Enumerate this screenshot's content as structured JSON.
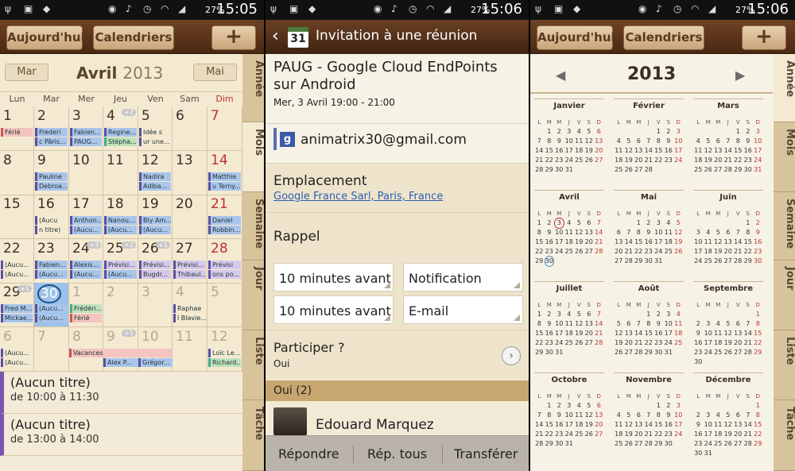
{
  "status_bar": {
    "time": "15:05",
    "battery": "27%",
    "time_p2": "15:06",
    "time_p3": "15:06"
  },
  "toolbar": {
    "today_label": "Aujourd'hui",
    "calendars_label": "Calendriers",
    "add_label": "+"
  },
  "colors": {
    "toolbar": "#5a3218",
    "sunday": "#c0322a",
    "selected": "#9cc2e8",
    "event_blue": "#a9c5ea",
    "event_red": "#f3c4c0",
    "event_green": "#bde1bc",
    "event_purple": "#d6c9ec"
  },
  "side_tabs": [
    "Année",
    "Mois",
    "Semaine",
    "Jour",
    "Liste",
    "Tâche"
  ],
  "month_view": {
    "prev": "Mar",
    "next": "Mai",
    "title": "Avril",
    "year": "2013",
    "weekdays": [
      "Lun",
      "Mar",
      "Mer",
      "Jeu",
      "Ven",
      "Sam",
      "Dim"
    ],
    "weeks": [
      [
        {
          "n": "1",
          "ev": [
            {
              "t": "Férié",
              "c": "r"
            }
          ]
        },
        {
          "n": "2",
          "ev": [
            {
              "t": "Frederi",
              "c": "b"
            },
            {
              "t": "c Pâris...",
              "c": "b"
            }
          ]
        },
        {
          "n": "3",
          "ev": [
            {
              "t": "Fabien...",
              "c": "b"
            },
            {
              "t": "PAUG...",
              "c": "b"
            }
          ]
        },
        {
          "n": "4",
          "more": "+2",
          "ev": [
            {
              "t": "Regine...",
              "c": "b"
            },
            {
              "t": "Stépha...",
              "c": "g"
            }
          ]
        },
        {
          "n": "5",
          "ev": [
            {
              "t": "Idée s",
              "c": "t"
            },
            {
              "t": "ur une...",
              "c": "t"
            }
          ]
        },
        {
          "n": "6",
          "ev": []
        },
        {
          "n": "7",
          "ev": []
        }
      ],
      [
        {
          "n": "8",
          "ev": []
        },
        {
          "n": "9",
          "ev": [
            {
              "t": "Pauline",
              "c": "b"
            },
            {
              "t": "Debroa...",
              "c": "b"
            }
          ]
        },
        {
          "n": "10",
          "ev": []
        },
        {
          "n": "11",
          "ev": []
        },
        {
          "n": "12",
          "ev": [
            {
              "t": "Nadira",
              "c": "b"
            },
            {
              "t": "Adiba...",
              "c": "b"
            }
          ]
        },
        {
          "n": "13",
          "ev": []
        },
        {
          "n": "14",
          "ev": [
            {
              "t": "Matthie",
              "c": "b"
            },
            {
              "t": "u Terny...",
              "c": "b"
            }
          ]
        }
      ],
      [
        {
          "n": "15",
          "ev": []
        },
        {
          "n": "16",
          "ev": [
            {
              "t": "(Aucu",
              "c": "t"
            },
            {
              "t": "n titre)",
              "c": "t"
            }
          ]
        },
        {
          "n": "17",
          "ev": [
            {
              "t": "Anthon...",
              "c": "b"
            },
            {
              "t": "(Aucu...",
              "c": "b"
            }
          ]
        },
        {
          "n": "18",
          "ev": [
            {
              "t": "Nanou...",
              "c": "b"
            },
            {
              "t": "(Aucu...",
              "c": "b"
            }
          ]
        },
        {
          "n": "19",
          "ev": [
            {
              "t": "Bly Am...",
              "c": "b"
            },
            {
              "t": "(Aucu...",
              "c": "b"
            }
          ]
        },
        {
          "n": "20",
          "ev": []
        },
        {
          "n": "21",
          "ev": [
            {
              "t": "Daniel",
              "c": "b"
            },
            {
              "t": "Robbin...",
              "c": "b"
            }
          ]
        }
      ],
      [
        {
          "n": "22",
          "ev": [
            {
              "t": "(Aucu...",
              "c": "t"
            },
            {
              "t": "(Aucu...",
              "c": "t"
            }
          ]
        },
        {
          "n": "23",
          "ev": [
            {
              "t": "Fabien...",
              "c": "b"
            },
            {
              "t": "(Aucu...",
              "c": "b"
            }
          ]
        },
        {
          "n": "24",
          "more": "+3",
          "ev": [
            {
              "t": "Alexis...",
              "c": "b"
            },
            {
              "t": "(Aucu...",
              "c": "b"
            }
          ]
        },
        {
          "n": "25",
          "more": "+2",
          "ev": [
            {
              "t": "Prévisi...",
              "c": "p"
            },
            {
              "t": "(Aucu...",
              "c": "b"
            }
          ]
        },
        {
          "n": "26",
          "more": "+1",
          "ev": [
            {
              "t": "Prévisi...",
              "c": "p"
            },
            {
              "t": "Bugdr...",
              "c": "p"
            }
          ]
        },
        {
          "n": "27",
          "ev": [
            {
              "t": "Prévisi...",
              "c": "p"
            },
            {
              "t": "Thibaul...",
              "c": "p"
            }
          ]
        },
        {
          "n": "28",
          "ev": [
            {
              "t": "Prévisi",
              "c": "p"
            },
            {
              "t": "ons po...",
              "c": "p"
            }
          ]
        }
      ],
      [
        {
          "n": "29",
          "more": "+1",
          "ev": [
            {
              "t": "Fred M...",
              "c": "b"
            },
            {
              "t": "Mickae...",
              "c": "b"
            }
          ]
        },
        {
          "n": "30",
          "today": true,
          "ev": [
            {
              "t": "(Aucu...",
              "c": "b"
            },
            {
              "t": "(Aucu...",
              "c": "b"
            }
          ]
        },
        {
          "n": "1",
          "other": true,
          "ev": [
            {
              "t": "Frédéri...",
              "c": "g"
            },
            {
              "t": "Férié",
              "c": "r"
            }
          ]
        },
        {
          "n": "2",
          "other": true,
          "ev": []
        },
        {
          "n": "3",
          "other": true,
          "ev": []
        },
        {
          "n": "4",
          "other": true,
          "ev": [
            {
              "t": "Raphae",
              "c": "t"
            },
            {
              "t": "l Blavie...",
              "c": "t"
            }
          ]
        },
        {
          "n": "5",
          "other": true,
          "ev": []
        }
      ],
      [
        {
          "n": "6",
          "other": true,
          "ev": [
            {
              "t": "(Aucu...",
              "c": "t"
            },
            {
              "t": "(Aucu...",
              "c": "t"
            }
          ]
        },
        {
          "n": "7",
          "other": true,
          "ev": []
        },
        {
          "n": "8",
          "other": true,
          "ev": []
        },
        {
          "n": "9",
          "other": true,
          "more": "+1",
          "ev": []
        },
        {
          "n": "10",
          "other": true,
          "ev": []
        },
        {
          "n": "11",
          "other": true,
          "ev": []
        },
        {
          "n": "12",
          "other": true,
          "ev": [
            {
              "t": "Loïc Le...",
              "c": "t"
            },
            {
              "t": "Richard...",
              "c": "g"
            }
          ]
        }
      ]
    ],
    "spans": [
      {
        "t": "Vacances",
        "c": "r"
      },
      {
        "t": "Alex P...",
        "c": "b"
      },
      {
        "t": "Grégor...",
        "c": "b"
      }
    ],
    "agenda": [
      {
        "title": "(Aucun titre)",
        "time": "de 10:00 à 11:30"
      },
      {
        "title": "(Aucun titre)",
        "time": "de 13:00 à 14:00"
      }
    ]
  },
  "event_detail": {
    "header": "Invitation à une réunion",
    "calendar_badge": "31",
    "title": "PAUG - Google Cloud EndPoints sur Android",
    "date": "Mer, 3 Avril 19:00 - 21:00",
    "account": "animatrix30@gmail.com",
    "location_label": "Emplacement",
    "location": "Google France Sarl, Paris, France",
    "reminder_label": "Rappel",
    "reminders": [
      {
        "time": "10 minutes avant",
        "type": "Notification"
      },
      {
        "time": "10 minutes avant",
        "type": "E-mail"
      }
    ],
    "attend_label": "Participer ?",
    "attend_value": "Oui",
    "yes_header": "Oui (2)",
    "attendee": "Edouard Marquez",
    "actions": [
      "Répondre",
      "Rép. tous",
      "Transférer"
    ]
  },
  "year_view": {
    "year": "2013",
    "dow": [
      "L",
      "M",
      "M",
      "J",
      "V",
      "S",
      "D"
    ],
    "months": [
      "Janvier",
      "Février",
      "Mars",
      "Avril",
      "Mai",
      "Juin",
      "Juillet",
      "Août",
      "Septembre",
      "Octobre",
      "Novembre",
      "Décembre"
    ]
  }
}
